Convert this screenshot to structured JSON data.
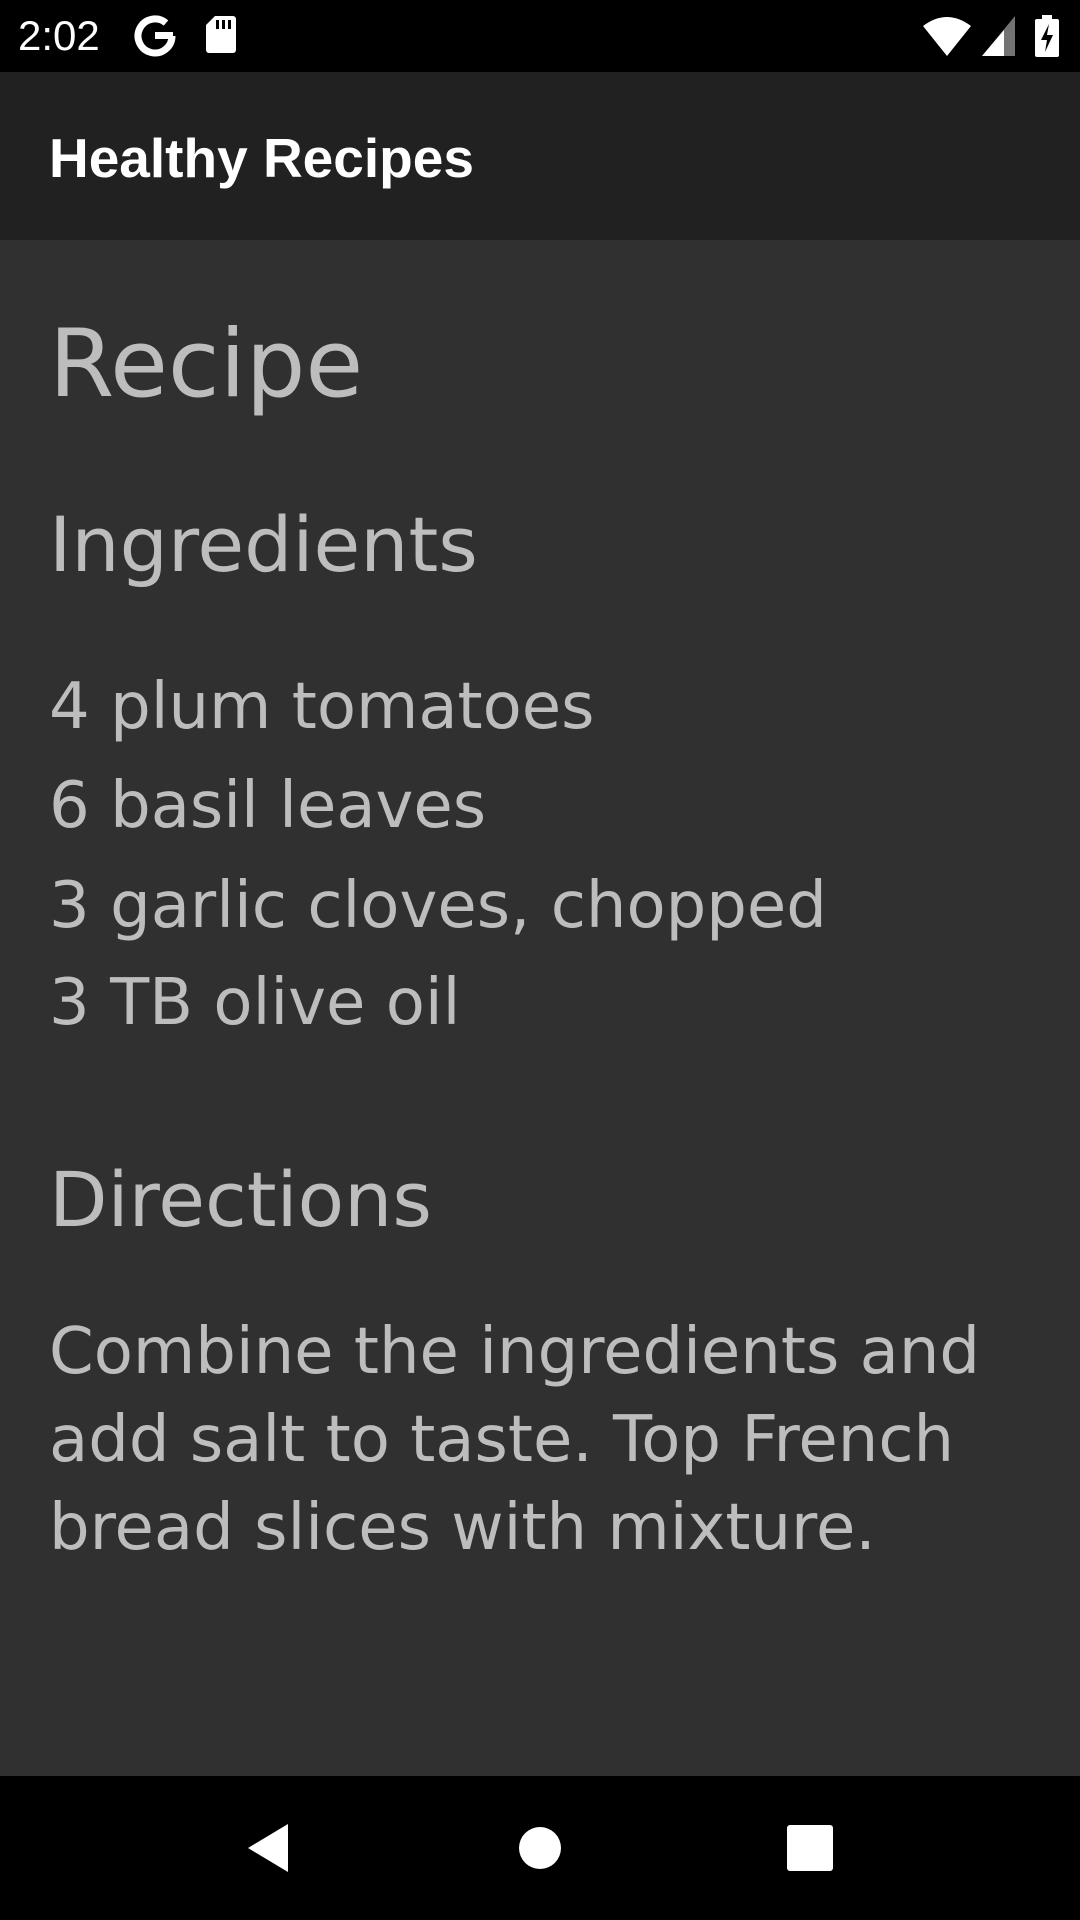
{
  "status_bar": {
    "time": "2:02",
    "icons": [
      "google-icon",
      "sd-card-icon",
      "wifi-icon",
      "cellular-signal-icon",
      "battery-charging-icon"
    ]
  },
  "app_bar": {
    "title": "Healthy Recipes",
    "background_color": "#212121"
  },
  "content": {
    "recipe_heading": "Recipe",
    "ingredients_heading": "Ingredients",
    "ingredients": [
      "4 plum tomatoes",
      "6 basil leaves",
      "3 garlic cloves, chopped",
      "3 TB olive oil"
    ],
    "directions_heading": "Directions",
    "directions_text": "Combine the ingredients and add salt to taste. Top French bread slices with mixture.",
    "background_color": "#303030",
    "text_color": "#bdbdbd"
  },
  "nav_bar": {
    "buttons": [
      "back-icon",
      "home-icon",
      "recents-icon"
    ]
  }
}
